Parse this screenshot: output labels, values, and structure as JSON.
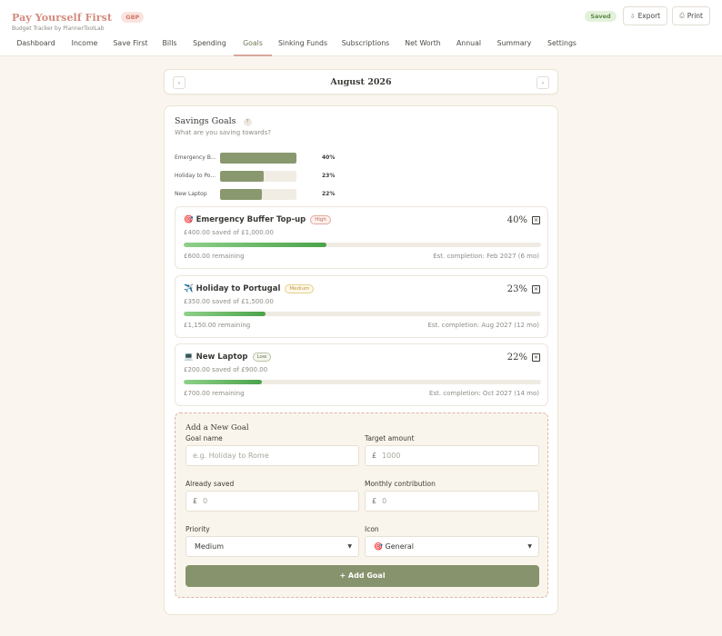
{
  "app": {
    "title": "Pay Yourself First",
    "currency_badge": "GBP",
    "subtitle": "Budget Tracker by PlannerToolLab",
    "saved_status": "Saved",
    "export_label": "Export",
    "print_label": "Print"
  },
  "nav": {
    "tabs": [
      {
        "label": "Dashboard"
      },
      {
        "label": "Income"
      },
      {
        "label": "Save First"
      },
      {
        "label": "Bills"
      },
      {
        "label": "Spending"
      },
      {
        "label": "Goals"
      },
      {
        "label": "Sinking Funds"
      },
      {
        "label": "Subscriptions"
      },
      {
        "label": "Net Worth"
      },
      {
        "label": "Annual"
      },
      {
        "label": "Summary"
      },
      {
        "label": "Settings"
      }
    ],
    "active": "Goals"
  },
  "month": {
    "label": "August 2026",
    "prev_icon": "‹",
    "next_icon": "›"
  },
  "goals_section": {
    "title": "Savings Goals",
    "help_icon": "?",
    "subtitle": "What are you saving towards?"
  },
  "overview": [
    {
      "label": "Emergency Buf...",
      "fraction": 1.0,
      "pct": "40%"
    },
    {
      "label": "Holiday to Po...",
      "fraction": 0.575,
      "pct": "23%"
    },
    {
      "label": "New Laptop",
      "fraction": 0.55,
      "pct": "22%"
    }
  ],
  "goals": [
    {
      "emoji": "🎯",
      "name": "Emergency Buffer Top-up",
      "priority": "High",
      "priority_class": "high",
      "pct": "40%",
      "progress": 0.4,
      "saved": "£400.00 saved of £1,000.00",
      "remaining": "£600.00 remaining",
      "estimate": "Est. completion: Feb 2027 (6 mo)",
      "close": "×"
    },
    {
      "emoji": "✈️",
      "name": "Holiday to Portugal",
      "priority": "Medium",
      "priority_class": "medium",
      "pct": "23%",
      "progress": 0.23,
      "saved": "£350.00 saved of £1,500.00",
      "remaining": "£1,150.00 remaining",
      "estimate": "Est. completion: Aug 2027 (12 mo)",
      "close": "×"
    },
    {
      "emoji": "💻",
      "name": "New Laptop",
      "priority": "Low",
      "priority_class": "low",
      "pct": "22%",
      "progress": 0.22,
      "saved": "£200.00 saved of £900.00",
      "remaining": "£700.00 remaining",
      "estimate": "Est. completion: Oct 2027 (14 mo)",
      "close": "×"
    }
  ],
  "form": {
    "title": "Add a New Goal",
    "goal_name_label": "Goal name",
    "goal_name_placeholder": "e.g. Holiday to Rome",
    "target_label": "Target amount",
    "target_placeholder": "1000",
    "already_label": "Already saved",
    "already_placeholder": "0",
    "monthly_label": "Monthly contribution",
    "monthly_placeholder": "0",
    "currency_symbol": "£",
    "priority_label": "Priority",
    "priority_value": "Medium",
    "icon_label": "Icon",
    "icon_value": "🎯 General",
    "add_button": "+ Add Goal"
  },
  "colors": {
    "accent": "#87936d",
    "brand": "#d48a7c",
    "progress": "#4aa34a"
  }
}
